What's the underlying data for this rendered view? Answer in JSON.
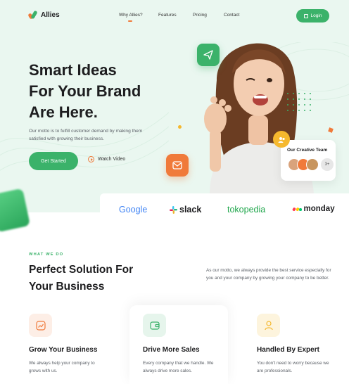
{
  "brand": {
    "name": "Allies",
    "icon": "allies-logo-icon",
    "accent": "#3bb26a",
    "orange": "#f07a3a",
    "yellow": "#f5b82e"
  },
  "nav": {
    "links": [
      {
        "label": "Why Allies?",
        "active": true
      },
      {
        "label": "Features"
      },
      {
        "label": "Pricing"
      },
      {
        "label": "Contact"
      }
    ],
    "login_label": "Login",
    "login_icon": "login-icon"
  },
  "hero": {
    "headline_lines": [
      "Smart Ideas",
      "For Your Brand",
      "Are Here."
    ],
    "motto": "Our motto is to fulfill customer demand by making them satisfied with growing their business.",
    "cta_label": "Get Started",
    "watch_label": "Watch Video",
    "watch_icon": "play-circle-icon",
    "team_card": {
      "title": "Our Creative Team",
      "more": "3+",
      "badge_icon": "users-icon"
    },
    "floating_icons": [
      "paper-plane-icon",
      "mail-icon"
    ]
  },
  "brands": [
    "Google",
    "slack",
    "tokopedia",
    "monday"
  ],
  "what_we_do": {
    "label": "WHAT WE DO",
    "title_lines": [
      "Perfect Solution For",
      "Your Business"
    ],
    "description": "As our motto, we always provide the best service especially for you and your company by growing your company to be better."
  },
  "features": [
    {
      "title": "Grow Your Business",
      "desc": "We always help your company to grows with us.",
      "icon": "growth-chart-icon",
      "tint": "#fdeee6",
      "color": "#f07a3a"
    },
    {
      "title": "Drive More Sales",
      "desc": "Every company that we handle. We always drive more sales.",
      "icon": "wallet-icon",
      "tint": "#e6f5ec",
      "color": "#3bb26a"
    },
    {
      "title": "Handled By Expert",
      "desc": "You don't need to worry because we are professionals.",
      "icon": "user-icon",
      "tint": "#fdf4dd",
      "color": "#f5b82e"
    }
  ]
}
